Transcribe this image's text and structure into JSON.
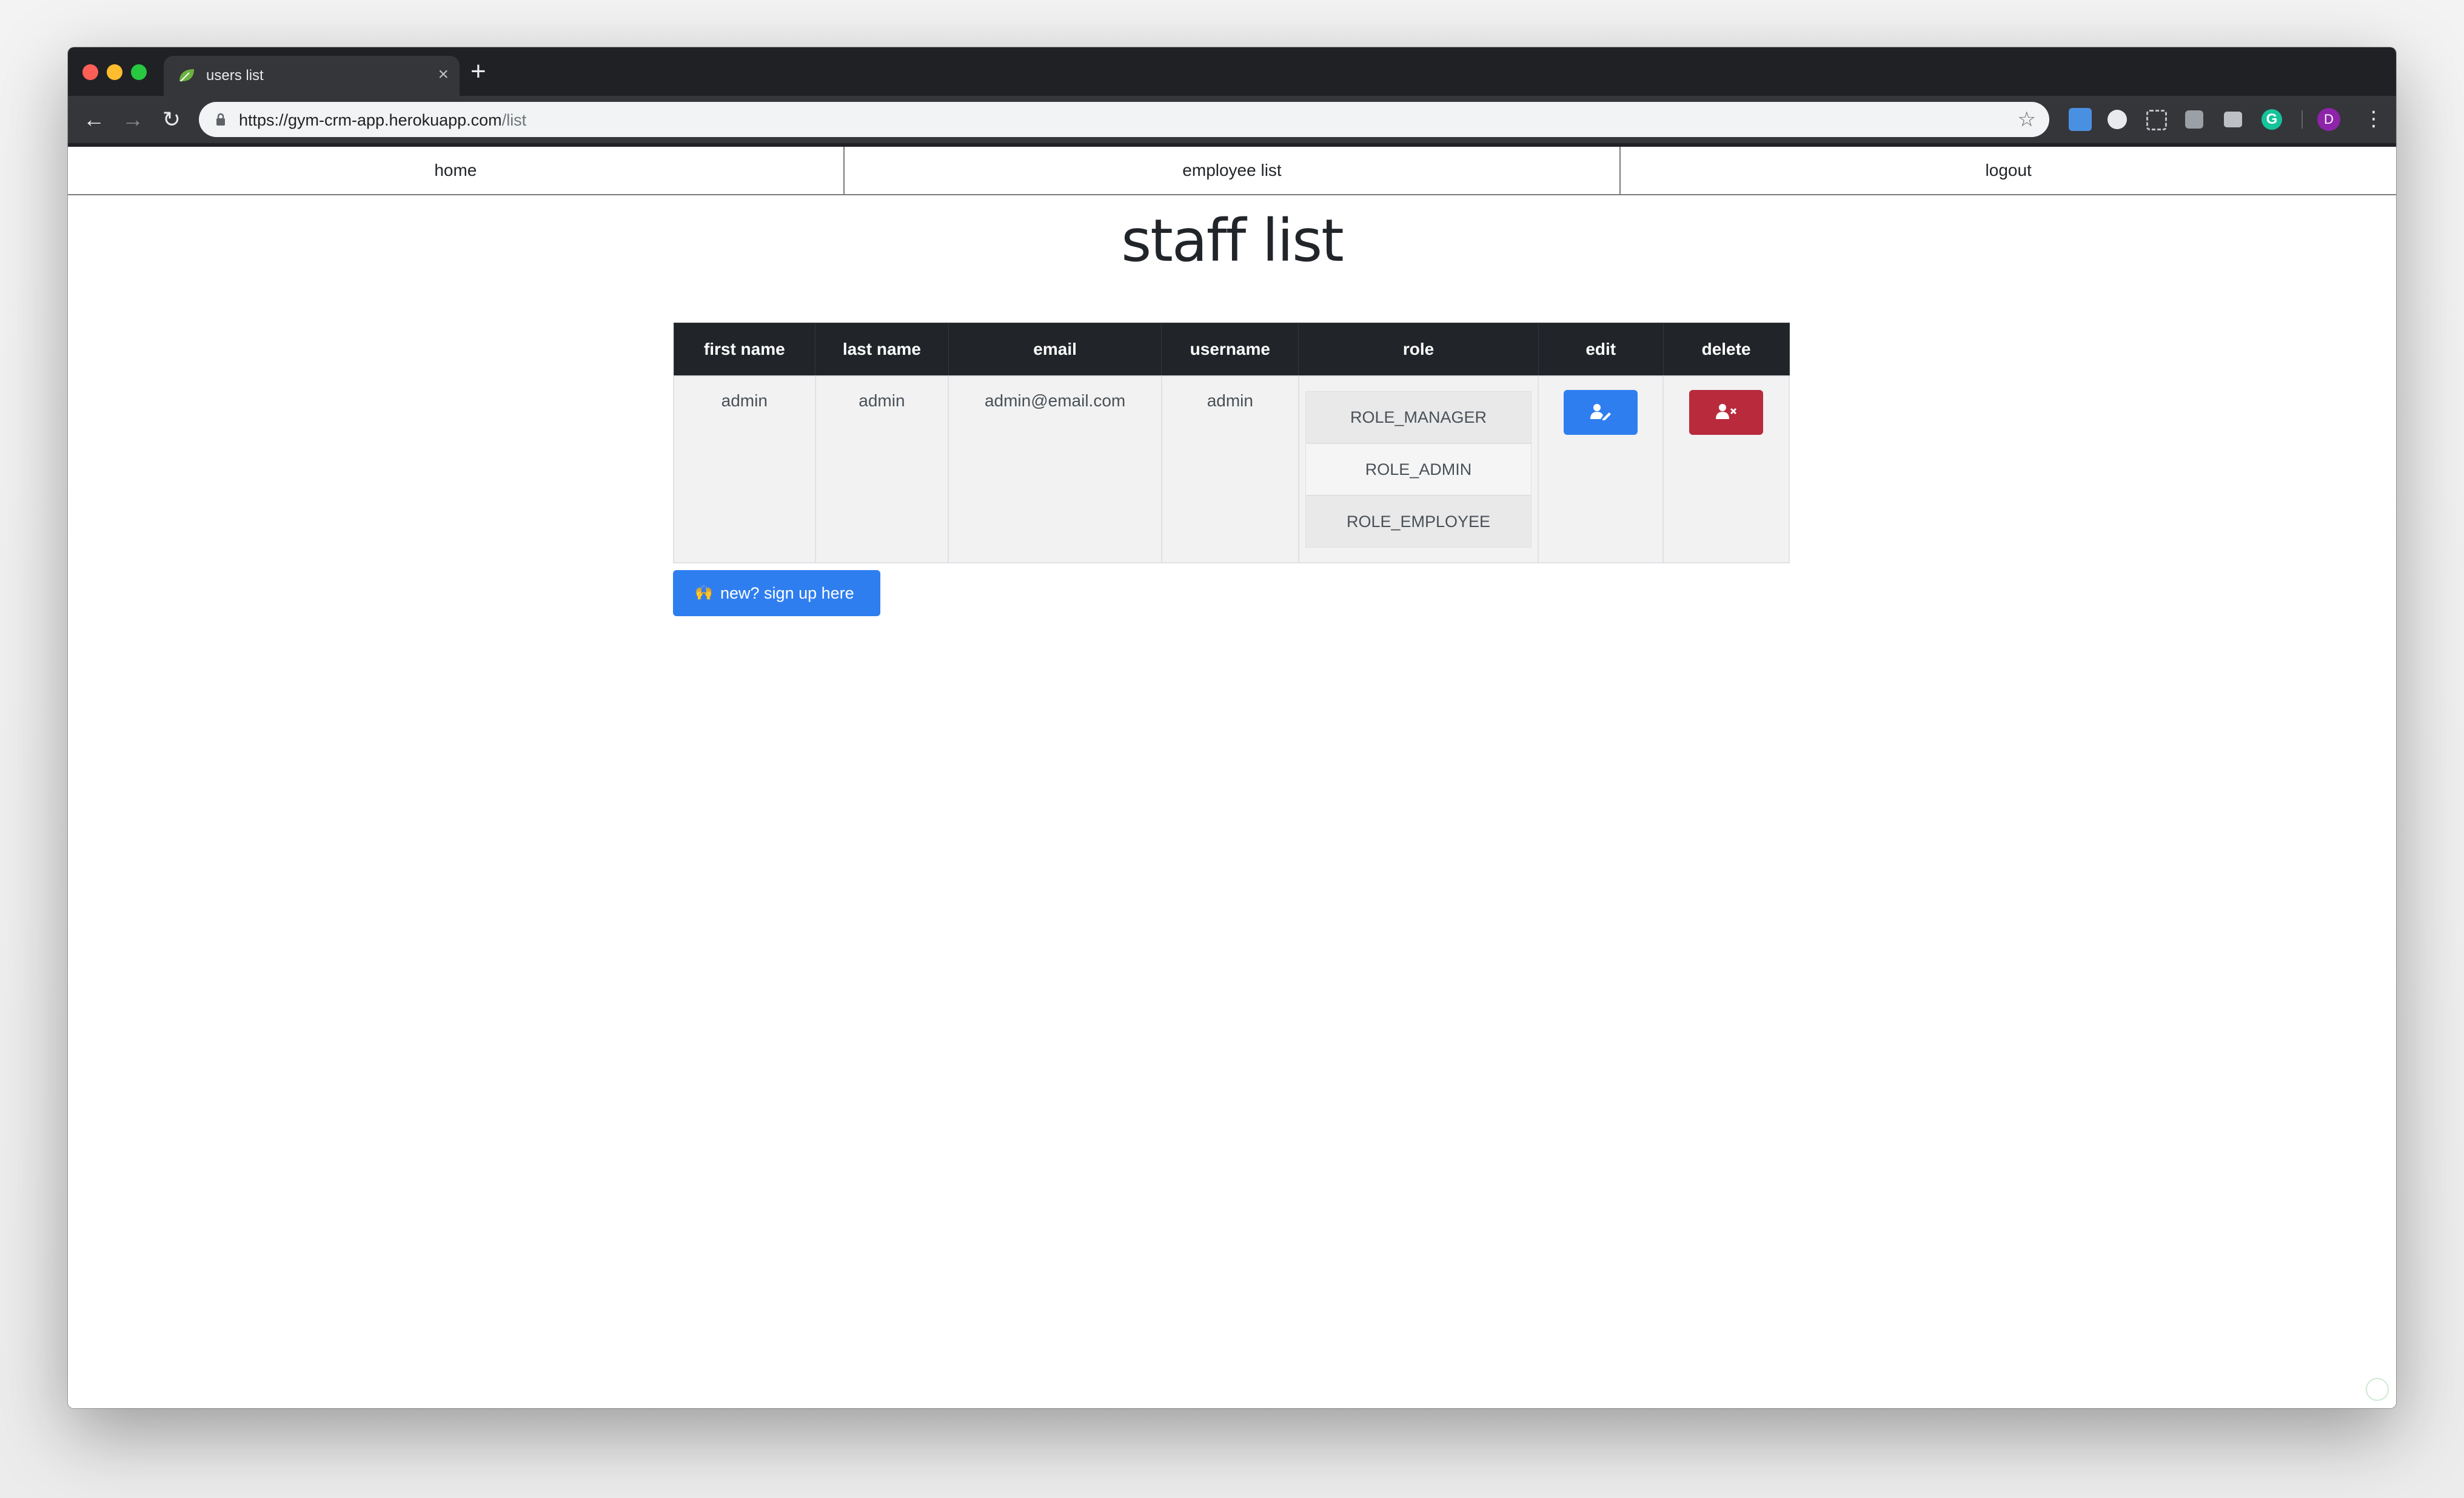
{
  "browser": {
    "tab_title": "users list",
    "tab_close": "×",
    "new_tab": "+",
    "url_host": "https://gym-crm-app.herokuapp.com",
    "url_path": "/list",
    "back": "←",
    "forward": "→",
    "reload": "↻",
    "star": "☆",
    "profile_initial": "D",
    "menu": "⋮",
    "grammarly": "G"
  },
  "nav": {
    "home": "home",
    "employee_list": "employee list",
    "logout": "logout"
  },
  "page_title": "staff list",
  "table": {
    "headers": [
      "first name",
      "last name",
      "email",
      "username",
      "role",
      "edit",
      "delete"
    ],
    "rows": [
      {
        "first_name": "admin",
        "last_name": "admin",
        "email": "admin@email.com",
        "username": "admin",
        "roles": [
          "ROLE_MANAGER",
          "ROLE_ADMIN",
          "ROLE_EMPLOYEE"
        ]
      }
    ]
  },
  "signup": {
    "icon": "🙌",
    "label": "new? sign up here"
  },
  "colors": {
    "primary": "#2f7ef0",
    "danger": "#b82a3c",
    "table_header": "#212529"
  }
}
